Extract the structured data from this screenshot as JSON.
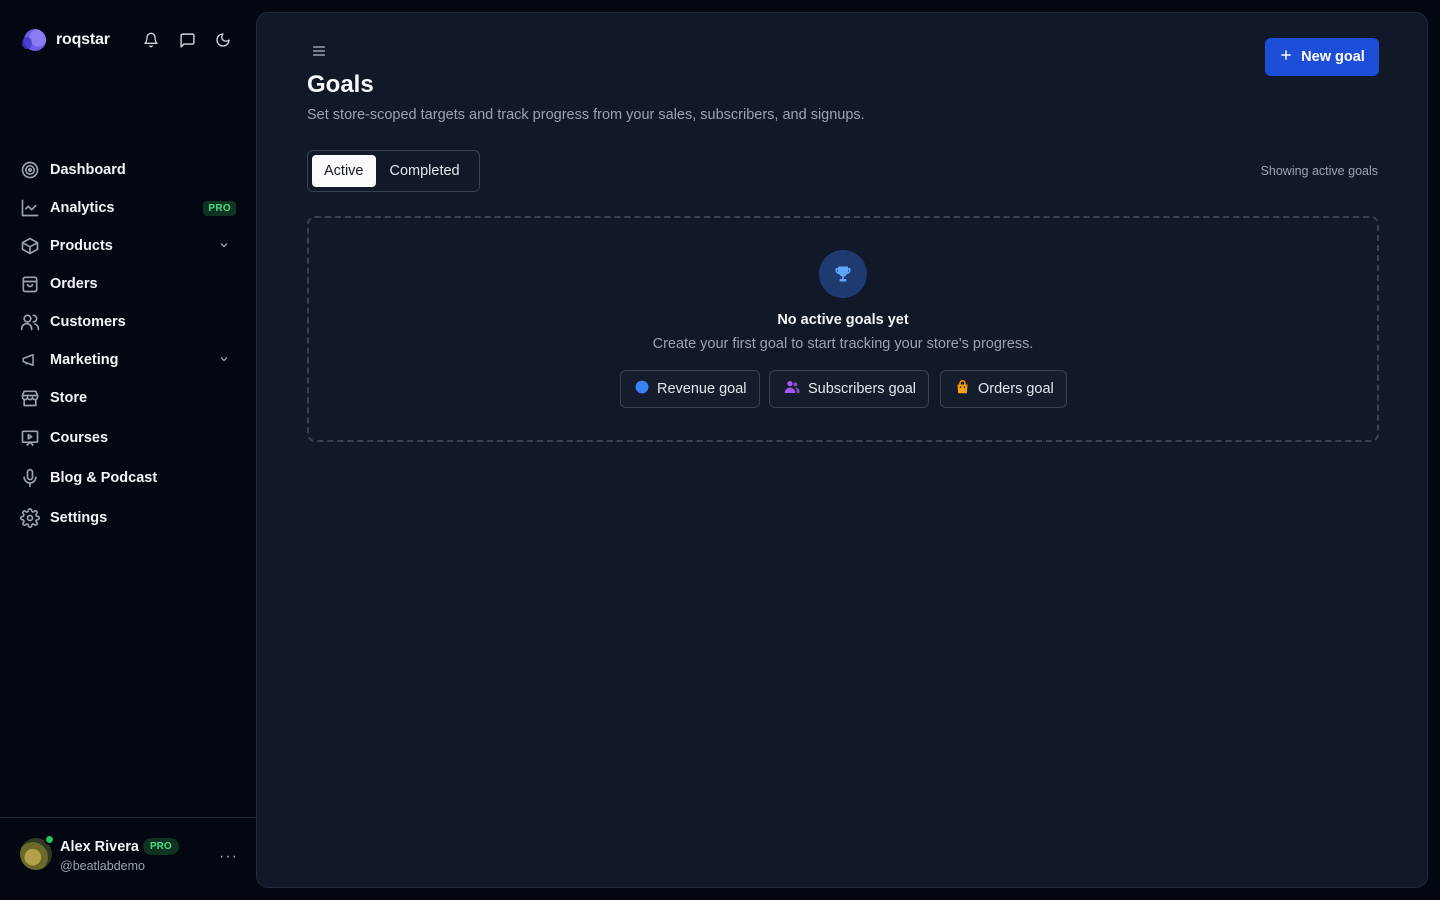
{
  "brand": {
    "name": "roqstar"
  },
  "sidebar": {
    "items": [
      {
        "label": "Dashboard",
        "icon": "dashboard-icon"
      },
      {
        "label": "Analytics",
        "icon": "chart-line-icon",
        "badge": "PRO"
      },
      {
        "label": "Products",
        "icon": "box-icon",
        "expandable": true
      },
      {
        "label": "Orders",
        "icon": "shopping-bag-icon"
      },
      {
        "label": "Customers",
        "icon": "users-icon"
      },
      {
        "label": "Marketing",
        "icon": "megaphone-icon",
        "expandable": true
      },
      {
        "label": "Store",
        "icon": "store-icon"
      },
      {
        "label": "Courses",
        "icon": "presentation-icon"
      },
      {
        "label": "Blog & Podcast",
        "icon": "microphone-icon"
      },
      {
        "label": "Settings",
        "icon": "gear-icon"
      }
    ]
  },
  "user": {
    "name": "Alex Rivera",
    "badge": "PRO",
    "handle": "@beatlabdemo",
    "online": true
  },
  "main": {
    "title": "Goals",
    "subtitle": "Set store-scoped targets and track progress from your sales, subscribers, and signups.",
    "new_goal_label": "New goal",
    "tabs": [
      {
        "label": "Active",
        "active": true
      },
      {
        "label": "Completed",
        "active": false
      }
    ],
    "showing_text": "Showing active goals",
    "empty": {
      "title": "No active goals yet",
      "subtitle": "Create your first goal to start tracking your store's progress.",
      "actions": [
        {
          "label": "Revenue goal",
          "icon": "dollar-circle-icon",
          "color": "#3b82f6"
        },
        {
          "label": "Subscribers goal",
          "icon": "users-icon",
          "color": "#a855f7"
        },
        {
          "label": "Orders goal",
          "icon": "shopping-bag-icon",
          "color": "#f59e0b"
        }
      ]
    }
  },
  "colors": {
    "accent": "#1d4ed8",
    "pro": "#4ade80",
    "background": "#030712",
    "panel": "#111827"
  }
}
